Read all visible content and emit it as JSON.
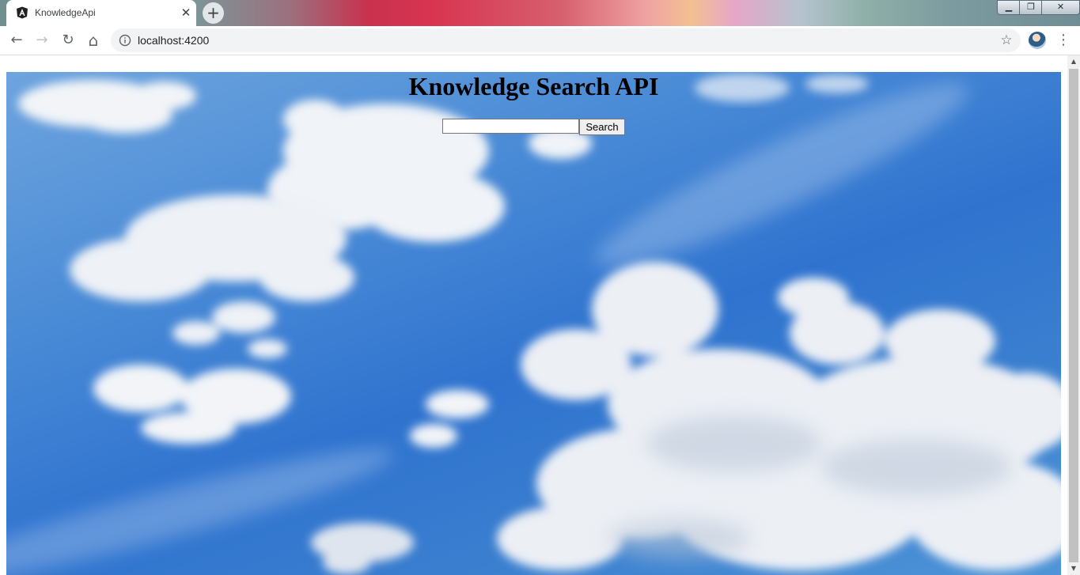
{
  "browser": {
    "tab": {
      "title": "KnowledgeApi",
      "favicon": "angular-icon",
      "close_glyph": "✕"
    },
    "new_tab_glyph": "+",
    "window_controls": {
      "minimize": "▁",
      "maximize": "❐",
      "close": "✕"
    },
    "toolbar": {
      "back_glyph": "←",
      "forward_glyph": "→",
      "reload_glyph": "↻",
      "home_glyph": "⌂",
      "url": "localhost:4200",
      "bookmark_glyph": "☆",
      "menu_glyph": "⋮"
    }
  },
  "page": {
    "title": "Knowledge Search API",
    "search": {
      "value": "",
      "placeholder": "",
      "button_label": "Search"
    },
    "background": "sky-with-clouds-image"
  },
  "scrollbar": {
    "up_glyph": "▲",
    "down_glyph": "▼"
  },
  "colors": {
    "sky_top": "#6ea4de",
    "sky_mid": "#2f73cf",
    "cloud": "#f2f4f7",
    "tab_bg": "#ffffff",
    "omnibox_bg": "#f1f3f4"
  }
}
